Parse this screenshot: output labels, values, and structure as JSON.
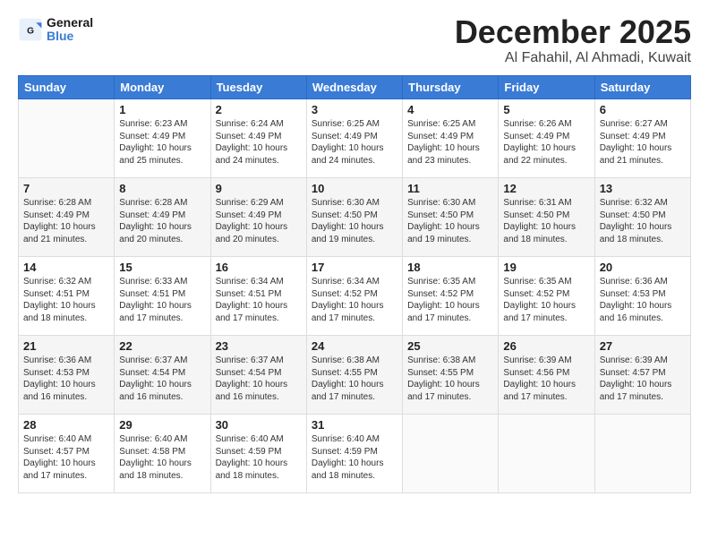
{
  "logo": {
    "text_general": "General",
    "text_blue": "Blue"
  },
  "header": {
    "month": "December 2025",
    "location": "Al Fahahil, Al Ahmadi, Kuwait"
  },
  "weekdays": [
    "Sunday",
    "Monday",
    "Tuesday",
    "Wednesday",
    "Thursday",
    "Friday",
    "Saturday"
  ],
  "weeks": [
    [
      {
        "day": "",
        "info": ""
      },
      {
        "day": "1",
        "info": "Sunrise: 6:23 AM\nSunset: 4:49 PM\nDaylight: 10 hours\nand 25 minutes."
      },
      {
        "day": "2",
        "info": "Sunrise: 6:24 AM\nSunset: 4:49 PM\nDaylight: 10 hours\nand 24 minutes."
      },
      {
        "day": "3",
        "info": "Sunrise: 6:25 AM\nSunset: 4:49 PM\nDaylight: 10 hours\nand 24 minutes."
      },
      {
        "day": "4",
        "info": "Sunrise: 6:25 AM\nSunset: 4:49 PM\nDaylight: 10 hours\nand 23 minutes."
      },
      {
        "day": "5",
        "info": "Sunrise: 6:26 AM\nSunset: 4:49 PM\nDaylight: 10 hours\nand 22 minutes."
      },
      {
        "day": "6",
        "info": "Sunrise: 6:27 AM\nSunset: 4:49 PM\nDaylight: 10 hours\nand 21 minutes."
      }
    ],
    [
      {
        "day": "7",
        "info": "Sunrise: 6:28 AM\nSunset: 4:49 PM\nDaylight: 10 hours\nand 21 minutes."
      },
      {
        "day": "8",
        "info": "Sunrise: 6:28 AM\nSunset: 4:49 PM\nDaylight: 10 hours\nand 20 minutes."
      },
      {
        "day": "9",
        "info": "Sunrise: 6:29 AM\nSunset: 4:49 PM\nDaylight: 10 hours\nand 20 minutes."
      },
      {
        "day": "10",
        "info": "Sunrise: 6:30 AM\nSunset: 4:50 PM\nDaylight: 10 hours\nand 19 minutes."
      },
      {
        "day": "11",
        "info": "Sunrise: 6:30 AM\nSunset: 4:50 PM\nDaylight: 10 hours\nand 19 minutes."
      },
      {
        "day": "12",
        "info": "Sunrise: 6:31 AM\nSunset: 4:50 PM\nDaylight: 10 hours\nand 18 minutes."
      },
      {
        "day": "13",
        "info": "Sunrise: 6:32 AM\nSunset: 4:50 PM\nDaylight: 10 hours\nand 18 minutes."
      }
    ],
    [
      {
        "day": "14",
        "info": "Sunrise: 6:32 AM\nSunset: 4:51 PM\nDaylight: 10 hours\nand 18 minutes."
      },
      {
        "day": "15",
        "info": "Sunrise: 6:33 AM\nSunset: 4:51 PM\nDaylight: 10 hours\nand 17 minutes."
      },
      {
        "day": "16",
        "info": "Sunrise: 6:34 AM\nSunset: 4:51 PM\nDaylight: 10 hours\nand 17 minutes."
      },
      {
        "day": "17",
        "info": "Sunrise: 6:34 AM\nSunset: 4:52 PM\nDaylight: 10 hours\nand 17 minutes."
      },
      {
        "day": "18",
        "info": "Sunrise: 6:35 AM\nSunset: 4:52 PM\nDaylight: 10 hours\nand 17 minutes."
      },
      {
        "day": "19",
        "info": "Sunrise: 6:35 AM\nSunset: 4:52 PM\nDaylight: 10 hours\nand 17 minutes."
      },
      {
        "day": "20",
        "info": "Sunrise: 6:36 AM\nSunset: 4:53 PM\nDaylight: 10 hours\nand 16 minutes."
      }
    ],
    [
      {
        "day": "21",
        "info": "Sunrise: 6:36 AM\nSunset: 4:53 PM\nDaylight: 10 hours\nand 16 minutes."
      },
      {
        "day": "22",
        "info": "Sunrise: 6:37 AM\nSunset: 4:54 PM\nDaylight: 10 hours\nand 16 minutes."
      },
      {
        "day": "23",
        "info": "Sunrise: 6:37 AM\nSunset: 4:54 PM\nDaylight: 10 hours\nand 16 minutes."
      },
      {
        "day": "24",
        "info": "Sunrise: 6:38 AM\nSunset: 4:55 PM\nDaylight: 10 hours\nand 17 minutes."
      },
      {
        "day": "25",
        "info": "Sunrise: 6:38 AM\nSunset: 4:55 PM\nDaylight: 10 hours\nand 17 minutes."
      },
      {
        "day": "26",
        "info": "Sunrise: 6:39 AM\nSunset: 4:56 PM\nDaylight: 10 hours\nand 17 minutes."
      },
      {
        "day": "27",
        "info": "Sunrise: 6:39 AM\nSunset: 4:57 PM\nDaylight: 10 hours\nand 17 minutes."
      }
    ],
    [
      {
        "day": "28",
        "info": "Sunrise: 6:40 AM\nSunset: 4:57 PM\nDaylight: 10 hours\nand 17 minutes."
      },
      {
        "day": "29",
        "info": "Sunrise: 6:40 AM\nSunset: 4:58 PM\nDaylight: 10 hours\nand 18 minutes."
      },
      {
        "day": "30",
        "info": "Sunrise: 6:40 AM\nSunset: 4:59 PM\nDaylight: 10 hours\nand 18 minutes."
      },
      {
        "day": "31",
        "info": "Sunrise: 6:40 AM\nSunset: 4:59 PM\nDaylight: 10 hours\nand 18 minutes."
      },
      {
        "day": "",
        "info": ""
      },
      {
        "day": "",
        "info": ""
      },
      {
        "day": "",
        "info": ""
      }
    ]
  ]
}
